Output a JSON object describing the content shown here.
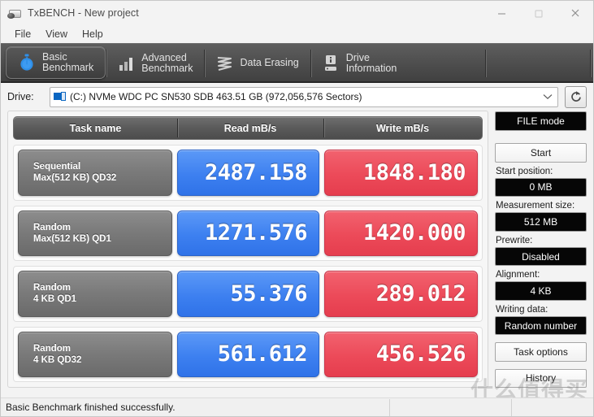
{
  "window": {
    "title": "TxBENCH - New project",
    "app_icon": "txbench-app-icon",
    "controls": {
      "minimize": "minimize-icon",
      "maximize": "maximize-icon",
      "close": "close-icon"
    }
  },
  "menubar": {
    "items": [
      {
        "label": "File"
      },
      {
        "label": "View"
      },
      {
        "label": "Help"
      }
    ]
  },
  "tabs": [
    {
      "label": "Basic\nBenchmark",
      "icon": "stopwatch-icon",
      "active": true
    },
    {
      "label": "Advanced\nBenchmark",
      "icon": "bar-chart-icon",
      "active": false
    },
    {
      "label": "Data Erasing",
      "icon": "shred-icon",
      "active": false
    },
    {
      "label": "Drive\nInformation",
      "icon": "drive-info-icon",
      "active": false
    }
  ],
  "drive": {
    "label": "Drive:",
    "selected": "(C:) NVMe WDC PC SN530 SDB  463.51 GB (972,056,576 Sectors)",
    "icon": "drive-icon",
    "dropdown_icon": "chevron-down-icon",
    "refresh_icon": "refresh-icon"
  },
  "results": {
    "columns": [
      "Task name",
      "Read mB/s",
      "Write mB/s"
    ],
    "rows": [
      {
        "task_line1": "Sequential",
        "task_line2": "Max(512 KB) QD32",
        "read": "2487.158",
        "write": "1848.180"
      },
      {
        "task_line1": "Random",
        "task_line2": "Max(512 KB) QD1",
        "read": "1271.576",
        "write": "1420.000"
      },
      {
        "task_line1": "Random",
        "task_line2": "4 KB QD1",
        "read": "55.376",
        "write": "289.012"
      },
      {
        "task_line1": "Random",
        "task_line2": "4 KB QD32",
        "read": "561.612",
        "write": "456.526"
      }
    ]
  },
  "sidebar": {
    "mode_value": "FILE mode",
    "start_button": "Start",
    "start_position_label": "Start position:",
    "start_position_value": "0 MB",
    "measurement_size_label": "Measurement size:",
    "measurement_size_value": "512 MB",
    "prewrite_label": "Prewrite:",
    "prewrite_value": "Disabled",
    "alignment_label": "Alignment:",
    "alignment_value": "4 KB",
    "writing_data_label": "Writing data:",
    "writing_data_value": "Random number",
    "task_options_button": "Task options",
    "history_button": "History"
  },
  "statusbar": {
    "message": "Basic Benchmark finished successfully."
  },
  "watermark": {
    "text": "什么值得买"
  },
  "colors": {
    "read_blue": "#3d80f0",
    "write_red": "#ec4a59",
    "tab_active_blue": "#2f8fe8",
    "toolbar_dark": "#4a4a4a",
    "dark_field": "#060606"
  }
}
